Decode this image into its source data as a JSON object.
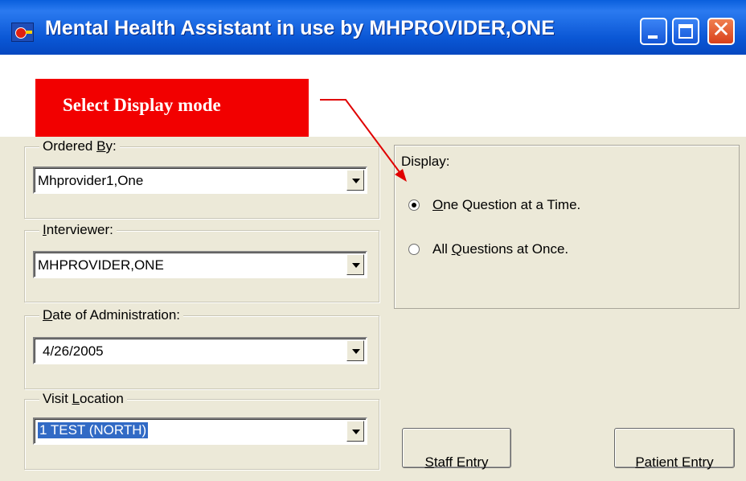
{
  "window": {
    "title": "Mental Health Assistant in use by MHPROVIDER,ONE",
    "controls": {
      "minimize": "minimize",
      "maximize": "maximize",
      "close": "✕"
    }
  },
  "callout": {
    "text": "Select Display mode",
    "color": "#f20000"
  },
  "form": {
    "ordered_by": {
      "label_pre": "Ordered ",
      "label_u": "B",
      "label_post": "y:",
      "value": "Mhprovider1,One"
    },
    "interviewer": {
      "label_pre": "",
      "label_u": "I",
      "label_post": "nterviewer:",
      "value": "MHPROVIDER,ONE"
    },
    "date": {
      "label_pre": "",
      "label_u": "D",
      "label_post": "ate of Administration:",
      "value": "4/26/2005"
    },
    "location": {
      "label_pre": "Visit ",
      "label_u": "L",
      "label_post": "ocation",
      "value": "1 TEST (NORTH)"
    }
  },
  "display": {
    "label": "Display:",
    "options": [
      {
        "pre": "",
        "u": "O",
        "post": "ne Question at a Time.",
        "checked": true
      },
      {
        "pre": "All ",
        "u": "Q",
        "post": "uestions at Once.",
        "checked": false
      }
    ]
  },
  "buttons": {
    "staff": {
      "pre": "",
      "u": "S",
      "post": "taff Entry"
    },
    "patient": {
      "pre": "",
      "u": "P",
      "post": "atient Entry"
    }
  },
  "colors": {
    "titlebar": "#0a57d5",
    "client_bg": "#ece9d8",
    "selection": "#316ac5",
    "arrow": "#e00000"
  }
}
